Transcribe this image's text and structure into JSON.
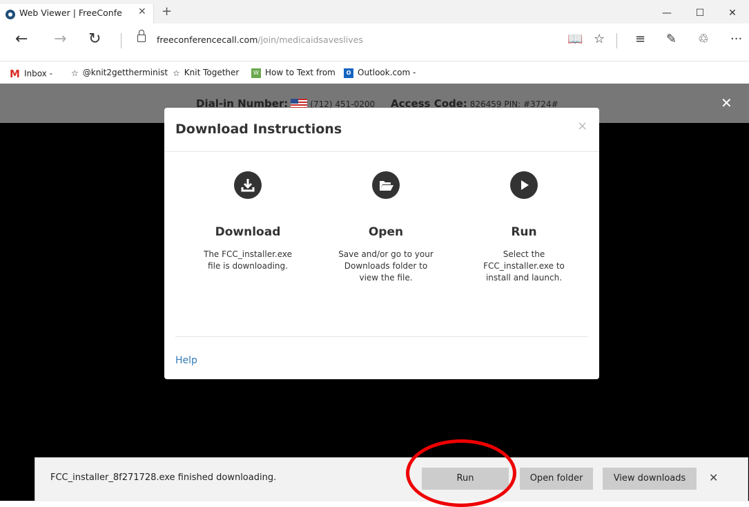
{
  "browser": {
    "tab_title": "Web Viewer | FreeConfe",
    "tab_close": "✕",
    "new_tab": "+",
    "window_controls": {
      "minimize": "—",
      "maximize": "☐",
      "close": "✕"
    },
    "nav": {
      "back": "←",
      "forward": "→",
      "refresh": "↻"
    },
    "url_domain": "freeconferencecall.com",
    "url_path": "/join/medicaidsaveslives",
    "toolbar": {
      "reading_view": "📖",
      "favorite": "☆",
      "hub": "≡",
      "notes": "✎",
      "share": "♲",
      "more": "···"
    }
  },
  "favorites": [
    {
      "icon": "gmail-icon",
      "label": "Inbox -"
    },
    {
      "icon": "star-icon",
      "label": "@knit2gettherminist"
    },
    {
      "icon": "star-icon",
      "label": "Knit Together"
    },
    {
      "icon": "webhost-icon",
      "label": "How to Text from"
    },
    {
      "icon": "outlook-icon",
      "label": "Outlook.com -"
    }
  ],
  "conference": {
    "dialin_label": "Dial-in Number:",
    "dialin_number": "(712) 451-0200",
    "access_label": "Access Code:",
    "access_code": "826459 PIN: #3724#",
    "close": "✕"
  },
  "modal": {
    "title": "Download Instructions",
    "close": "×",
    "steps": [
      {
        "icon": "download-icon",
        "title": "Download",
        "desc": "The FCC_installer.exe file is downloading."
      },
      {
        "icon": "folder-open-icon",
        "title": "Open",
        "desc": "Save and/or go to your Downloads folder to view the file."
      },
      {
        "icon": "play-icon",
        "title": "Run",
        "desc": "Select the FCC_installer.exe to install and launch."
      }
    ],
    "help": "Help"
  },
  "download_bar": {
    "message": "FCC_installer_8f271728.exe finished downloading.",
    "run": "Run",
    "open_folder": "Open folder",
    "view_downloads": "View downloads",
    "close": "✕"
  },
  "colors": {
    "page_bg": "#000000",
    "strip_bg": "#777777",
    "link": "#337ab7",
    "highlight_ring": "#e00000"
  }
}
